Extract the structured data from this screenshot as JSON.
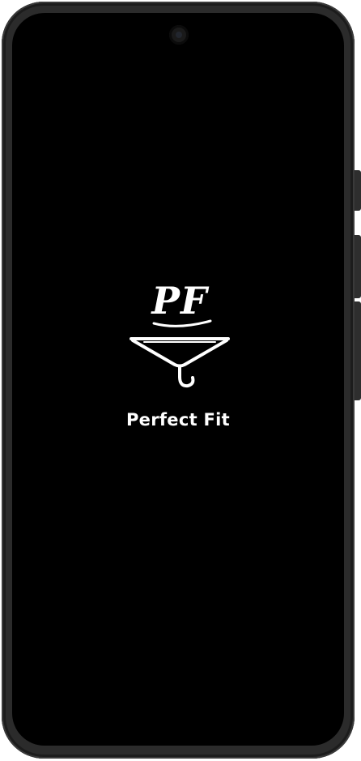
{
  "splash": {
    "logo_monogram": "PF",
    "app_name": "Perfect Fit"
  },
  "icons": {
    "logo": "hanger-logo-icon",
    "camera": "front-camera-icon"
  },
  "colors": {
    "screen_background": "#000000",
    "foreground": "#ffffff",
    "device_frame": "#2b2b2b"
  }
}
